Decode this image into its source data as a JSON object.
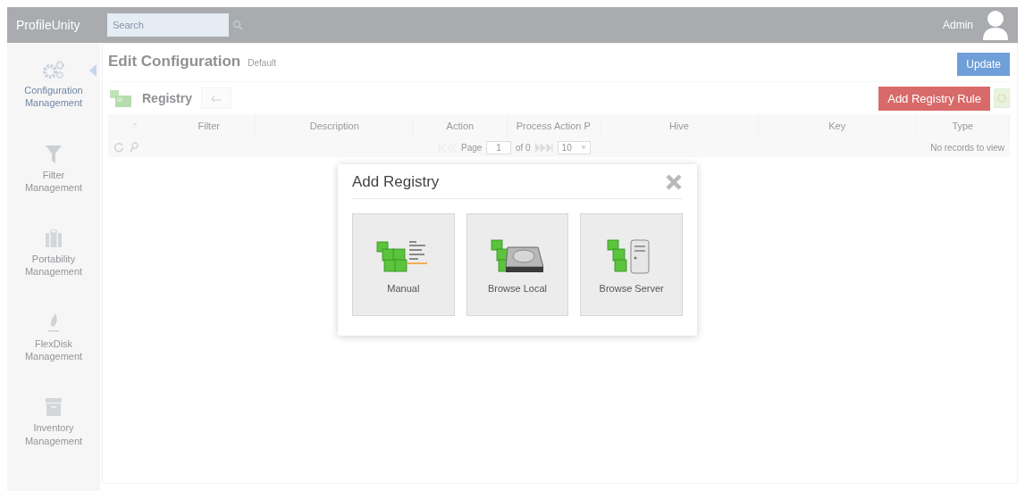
{
  "header": {
    "brand": "ProfileUnity",
    "search": {
      "placeholder": "Search"
    },
    "user": "Admin"
  },
  "sidebar": {
    "items": [
      {
        "label": "Configuration Management",
        "selected": true
      },
      {
        "label": "Filter Management",
        "selected": false
      },
      {
        "label": "Portability Management",
        "selected": false
      },
      {
        "label": "FlexDisk Management",
        "selected": false
      },
      {
        "label": "Inventory Management",
        "selected": false
      }
    ]
  },
  "page": {
    "title": "Edit Configuration",
    "subtitle": "Default",
    "update_button": "Update"
  },
  "section": {
    "title": "Registry",
    "add_button": "Add Registry Rule"
  },
  "table": {
    "columns": [
      "Filter",
      "Description",
      "Action",
      "Process Action P",
      "Hive",
      "Key",
      "Type"
    ],
    "pager": {
      "page_label": "Page",
      "page_value": "1",
      "of_label": "of 0",
      "page_size": "10"
    },
    "empty_message": "No records to view"
  },
  "modal": {
    "title": "Add Registry",
    "options": [
      {
        "label": "Manual"
      },
      {
        "label": "Browse Local"
      },
      {
        "label": "Browse Server"
      }
    ]
  }
}
